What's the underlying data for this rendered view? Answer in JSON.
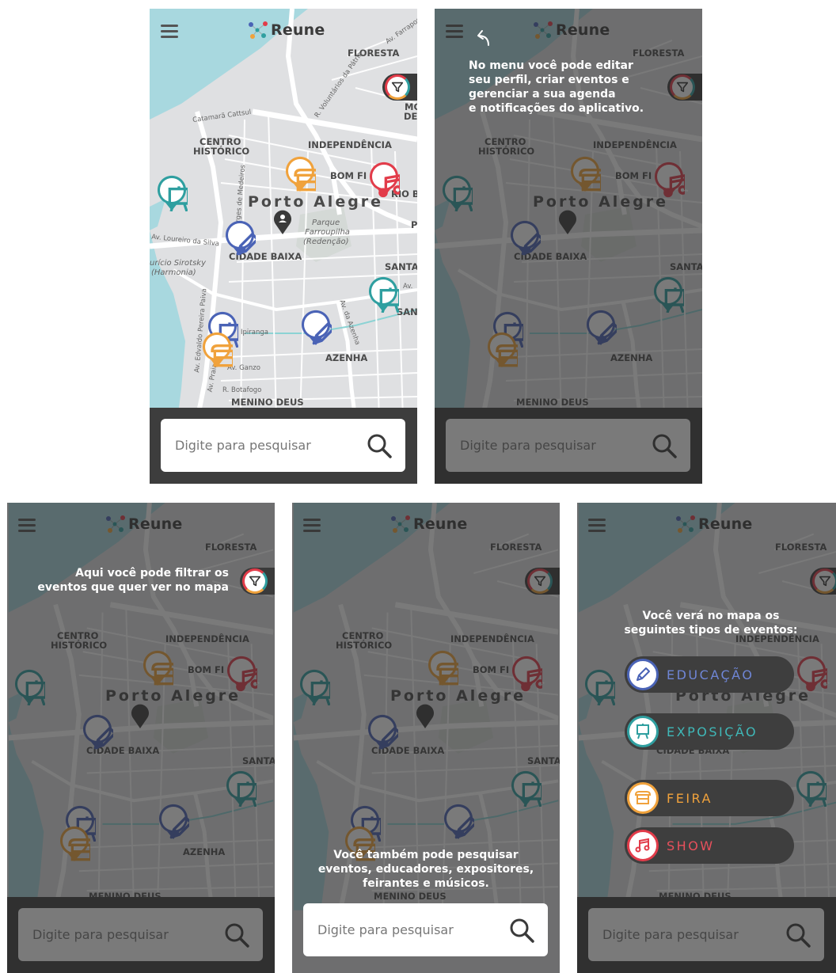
{
  "app": {
    "logo_text": "Reune"
  },
  "search": {
    "placeholder": "Digite para pesquisar"
  },
  "map": {
    "labels": {
      "floresta": "FLORESTA",
      "centro": "CENTRO",
      "historico": "HISTÓRICO",
      "independencia": "INDEPENDÊNCIA",
      "bom_fim": "BOM FI",
      "porto_alegre": "Porto Alegre",
      "cidade_baixa": "CIDADE BAIXA",
      "parque": "Parque",
      "farroupilha": "Farroupilha",
      "redencao": "(Redenção)",
      "azenha": "AZENHA",
      "menino_deus": "MENINO DEUS",
      "santa": "SANTA",
      "san": "SAN",
      "mo": "MO",
      "de": "DE",
      "rio_b": "RIO B",
      "p": "P",
      "auricio": "urício Sirotsky",
      "harmonia": "(Harmonia)",
      "av_loureiro": "Av. Loureiro da Silva",
      "av_borges": "Av. Borges de Medeiros",
      "catamara": "Catamarã Cattsul",
      "av_farrapos": "Av. Farrapos",
      "r_voluntarios": "R. Voluntários da Pátria",
      "av_ipiranga": "Ipiranga",
      "av_ganzo": "Av. Ganzo",
      "r_botafogo": "R. Botafogo",
      "av_praia": "Av. Praia",
      "av_edvaldo": "Av. Edvaldo Pereira Paiva",
      "av_azenha": "Av. da Azenha",
      "av": "Av."
    }
  },
  "tips": {
    "menu": [
      "No menu você pode editar",
      "seu perfil, criar eventos e",
      "gerenciar a sua agenda",
      "e notificações do aplicativo."
    ],
    "filter": [
      "Aqui você pode filtrar os",
      "eventos que quer ver no mapa"
    ],
    "search": [
      "Você também pode pesquisar",
      "eventos, educadores, expositores,",
      "feirantes e músicos."
    ],
    "types_intro": [
      "Você verá no mapa os",
      "seguintes tipos de eventos:"
    ]
  },
  "event_types": [
    {
      "label": "EDUCAÇÃO",
      "color": "#4a63b6",
      "icon": "pencil-icon"
    },
    {
      "label": "EXPOSIÇÃO",
      "color": "#2f9fa0",
      "icon": "easel-icon"
    },
    {
      "label": "FEIRA",
      "color": "#f0a23c",
      "icon": "market-stall-icon"
    },
    {
      "label": "SHOW",
      "color": "#e23c4a",
      "icon": "music-note-icon"
    }
  ],
  "colors": {
    "water": "#a8d8df",
    "land": "#dfe0e2",
    "road": "#ffffff",
    "dark_bar": "#3d3d3d",
    "overlay": "rgba(40,40,40,0.62)"
  }
}
